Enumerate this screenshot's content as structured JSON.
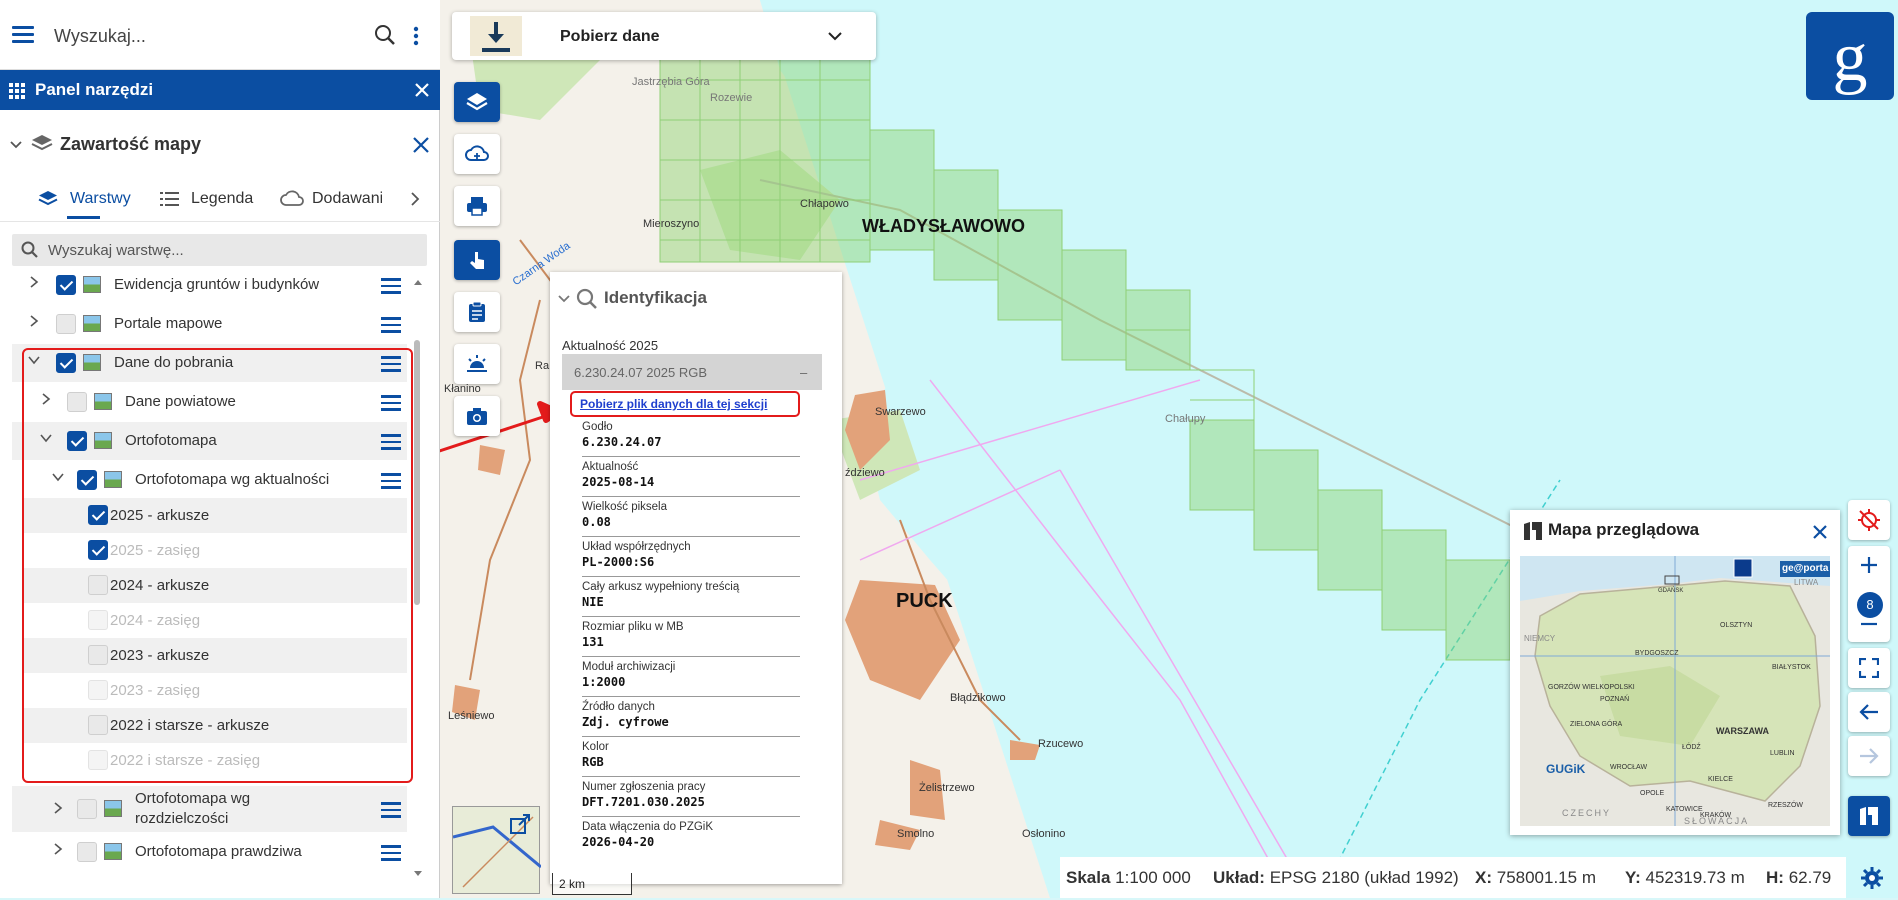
{
  "search": {
    "placeholder": "Wyszukaj..."
  },
  "panel": {
    "title": "Panel narzędzi"
  },
  "content": {
    "title": "Zawartość mapy"
  },
  "tabs": [
    {
      "label": "Warstwy",
      "active": true
    },
    {
      "label": "Legenda",
      "active": false
    },
    {
      "label": "Dodawanie",
      "active": false
    }
  ],
  "layer_search": {
    "placeholder": "Wyszukaj warstwę..."
  },
  "layers": {
    "row1": {
      "label": "Ewidencja gruntów i budynków",
      "checked": true
    },
    "row2": {
      "label": "Portale mapowe",
      "checked": false
    },
    "row3": {
      "label": "Dane do pobrania",
      "checked": true
    },
    "row4": {
      "label": "Dane powiatowe",
      "checked": false
    },
    "row5": {
      "label": "Ortofotomapa",
      "checked": true
    },
    "row6": {
      "label": "Ortofotomapa wg aktualności",
      "checked": true
    },
    "sub": [
      {
        "label": "2025 - arkusze",
        "checked": true,
        "dim": false
      },
      {
        "label": "2025 - zasięg",
        "checked": true,
        "dim": true
      },
      {
        "label": "2024 - arkusze",
        "checked": false,
        "dim": false
      },
      {
        "label": "2024 - zasięg",
        "checked": false,
        "dim": true
      },
      {
        "label": "2023 - arkusze",
        "checked": false,
        "dim": false
      },
      {
        "label": "2023 - zasięg",
        "checked": false,
        "dim": true
      },
      {
        "label": "2022 i starsze - arkusze",
        "checked": false,
        "dim": false
      },
      {
        "label": "2022 i starsze - zasięg",
        "checked": false,
        "dim": true
      }
    ],
    "row7a": {
      "label": "Ortofotomapa wg"
    },
    "row7b": {
      "label": "rozdzielczości"
    },
    "row8": {
      "label": "Ortofotomapa prawdziwa"
    }
  },
  "download_pill": {
    "title": "Pobierz dane"
  },
  "identify": {
    "title": "Identyfikacja",
    "actuality": "Aktualność 2025",
    "selected": "6.230.24.07 2025 RGB",
    "selected_dash": "–",
    "download_link": "Pobierz plik danych dla tej sekcji",
    "attributes": [
      {
        "key": "Godło",
        "value": "6.230.24.07"
      },
      {
        "key": "Aktualność",
        "value": "2025-08-14"
      },
      {
        "key": "Wielkość piksela",
        "value": "0.08"
      },
      {
        "key": "Układ współrzędnych",
        "value": "PL-2000:S6"
      },
      {
        "key": "Cały arkusz wypełniony treścią",
        "value": "NIE"
      },
      {
        "key": "Rozmiar pliku w MB",
        "value": "131"
      },
      {
        "key": "Moduł archiwizacji",
        "value": "1:2000"
      },
      {
        "key": "Źródło danych",
        "value": "Zdj. cyfrowe"
      },
      {
        "key": "Kolor",
        "value": "RGB"
      },
      {
        "key": "Numer zgłoszenia pracy",
        "value": "DFT.7201.030.2025"
      },
      {
        "key": "Data włączenia do PZGiK",
        "value": "2026-04-20"
      }
    ]
  },
  "overview": {
    "title": "Mapa przeglądowa",
    "badge": "ge@porta",
    "labels": {
      "warszawa": "WARSZAWA",
      "olsztyn": "OLSZTYN",
      "bialystok": "BIAŁYSTOK",
      "bydgoszcz": "BYDGOSZCZ",
      "gorzow": "GORZÓW WIELKOPOLSKI",
      "poznan": "POZNAŃ",
      "zielona": "ZIELONA GÓRA",
      "lodz": "ŁÓDŹ",
      "lublin": "LUBLIN",
      "wroclaw": "WROCŁAW",
      "kielce": "KIELCE",
      "opole": "OPOLE",
      "katowice": "KATOWICE",
      "krakow": "KRAKÓW",
      "rzeszow": "RZESZÓW",
      "czechy": "CZECHY",
      "slowacja": "SŁOWACJA",
      "litwa": "LITWA",
      "niemcy": "NIEMCY",
      "gdansk": "GDAŃSK",
      "logo": "GUGiK"
    }
  },
  "map_labels": {
    "wladyslawowo": "WŁADYSŁAWOWO",
    "puck": "PUCK",
    "mieroszyno": "Mieroszyno",
    "chlapowo": "Chłapowo",
    "swarzewo": "Swarzewo",
    "zdzewo": "ździewo",
    "bladzikowo": "Błądzikowo",
    "rzucewo": "Rzucewo",
    "zelistrzewo": "Żelistrzewo",
    "smolno": "Smolno",
    "oslonino": "Osłonino",
    "lesniewo": "Leśniewo",
    "chalupy": "Chałupy",
    "jastrzebia": "Jastrzębia Góra",
    "rozewie": "Rozewie",
    "czarna_woda": "Czarna Woda",
    "kaniino": "Kłanino",
    "ra": "Ra",
    "scale": "2 km"
  },
  "zoom": {
    "level": "8"
  },
  "status": {
    "scale_label": "Skala",
    "scale_value": "1:100 000",
    "crs_label": "Układ:",
    "crs_value": "EPSG 2180 (układ 1992)",
    "x_label": "X:",
    "x_value": "758001.15 m",
    "y_label": "Y:",
    "y_value": "452319.73 m",
    "h_label": "H:",
    "h_value": "62.79"
  },
  "colors": {
    "accent": "#0b4ea2",
    "highlight": "#e31b1b",
    "grid": "#9fdc8c"
  }
}
